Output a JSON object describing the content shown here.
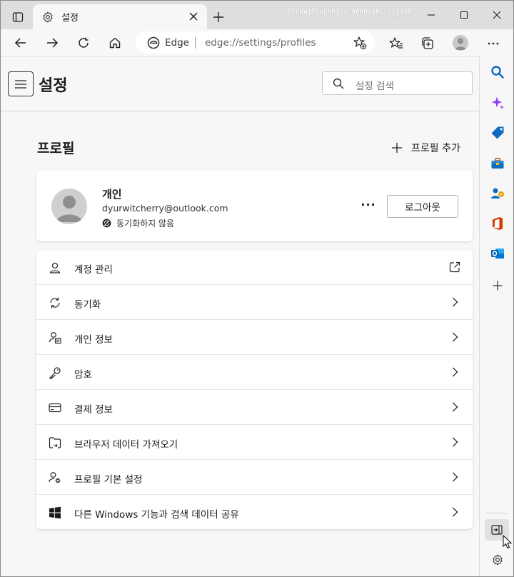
{
  "window": {
    "tab_title": "설정",
    "watermark_line1": "DYURWITCHERRY'S HARDWARE SECTOR",
    "watermark_line2": "BLOG COPYRIGHT © 2023 DYURWITCHERRY'S HARDWARE SECTOR ALL RIGHTS RESERVED"
  },
  "addressbar": {
    "site_name": "Edge",
    "url": "edge://settings/profiles"
  },
  "settings": {
    "title": "설정",
    "search_placeholder": "설정 검색"
  },
  "profiles": {
    "section_title": "프로필",
    "add_profile_label": "프로필 추가",
    "profile": {
      "name": "개인",
      "email": "dyurwitcherry@outlook.com",
      "sync_status": "동기화하지 않음",
      "more_label": "···",
      "logout_label": "로그아웃"
    },
    "items": [
      {
        "label": "계정 관리",
        "icon": "account-icon",
        "end": "external-link-icon"
      },
      {
        "label": "동기화",
        "icon": "sync-icon",
        "end": "chevron-right-icon"
      },
      {
        "label": "개인 정보",
        "icon": "personal-info-icon",
        "end": "chevron-right-icon"
      },
      {
        "label": "암호",
        "icon": "key-icon",
        "end": "chevron-right-icon"
      },
      {
        "label": "결제 정보",
        "icon": "card-icon",
        "end": "chevron-right-icon"
      },
      {
        "label": "브라우저 데이터 가져오기",
        "icon": "import-icon",
        "end": "chevron-right-icon"
      },
      {
        "label": "프로필 기본 설정",
        "icon": "profile-prefs-icon",
        "end": "chevron-right-icon"
      },
      {
        "label": "다른 Windows 기능과 검색 데이터 공유",
        "icon": "windows-icon",
        "end": "chevron-right-icon"
      }
    ]
  },
  "colors": {
    "accent_blue": "#0f6cbd",
    "office_red": "#d83b01",
    "outlook_blue": "#0078d4",
    "copilot_purple": "#8a3ffc"
  }
}
